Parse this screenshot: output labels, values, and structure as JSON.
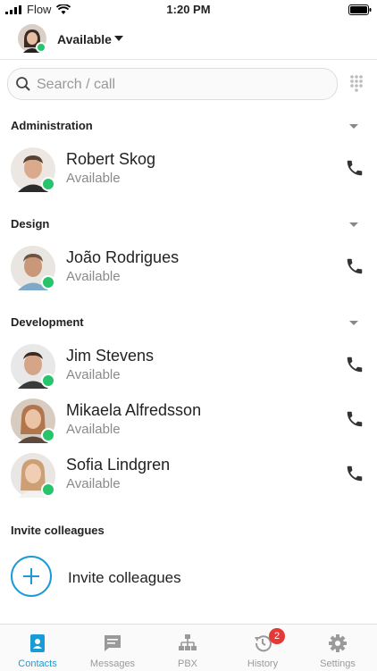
{
  "status_bar": {
    "carrier": "Flow",
    "time": "1:20 PM"
  },
  "presence": {
    "label": "Available"
  },
  "search": {
    "placeholder": "Search / call"
  },
  "sections": [
    {
      "title": "Administration"
    },
    {
      "title": "Design"
    },
    {
      "title": "Development"
    }
  ],
  "contacts": [
    {
      "name": "Robert Skog",
      "status": "Available"
    },
    {
      "name": "João Rodrigues",
      "status": "Available"
    },
    {
      "name": "Jim Stevens",
      "status": "Available"
    },
    {
      "name": "Mikaela Alfredsson",
      "status": "Available"
    },
    {
      "name": "Sofia Lindgren",
      "status": "Available"
    }
  ],
  "invite": {
    "section_title": "Invite colleagues",
    "label": "Invite colleagues"
  },
  "tabs": [
    {
      "label": "Contacts",
      "icon": "contacts-icon",
      "active": true
    },
    {
      "label": "Messages",
      "icon": "messages-icon"
    },
    {
      "label": "PBX",
      "icon": "pbx-icon"
    },
    {
      "label": "History",
      "icon": "history-icon",
      "badge": "2"
    },
    {
      "label": "Settings",
      "icon": "settings-icon"
    }
  ],
  "colors": {
    "accent": "#1a9bd7",
    "online": "#27c46b",
    "badge": "#e53935"
  }
}
